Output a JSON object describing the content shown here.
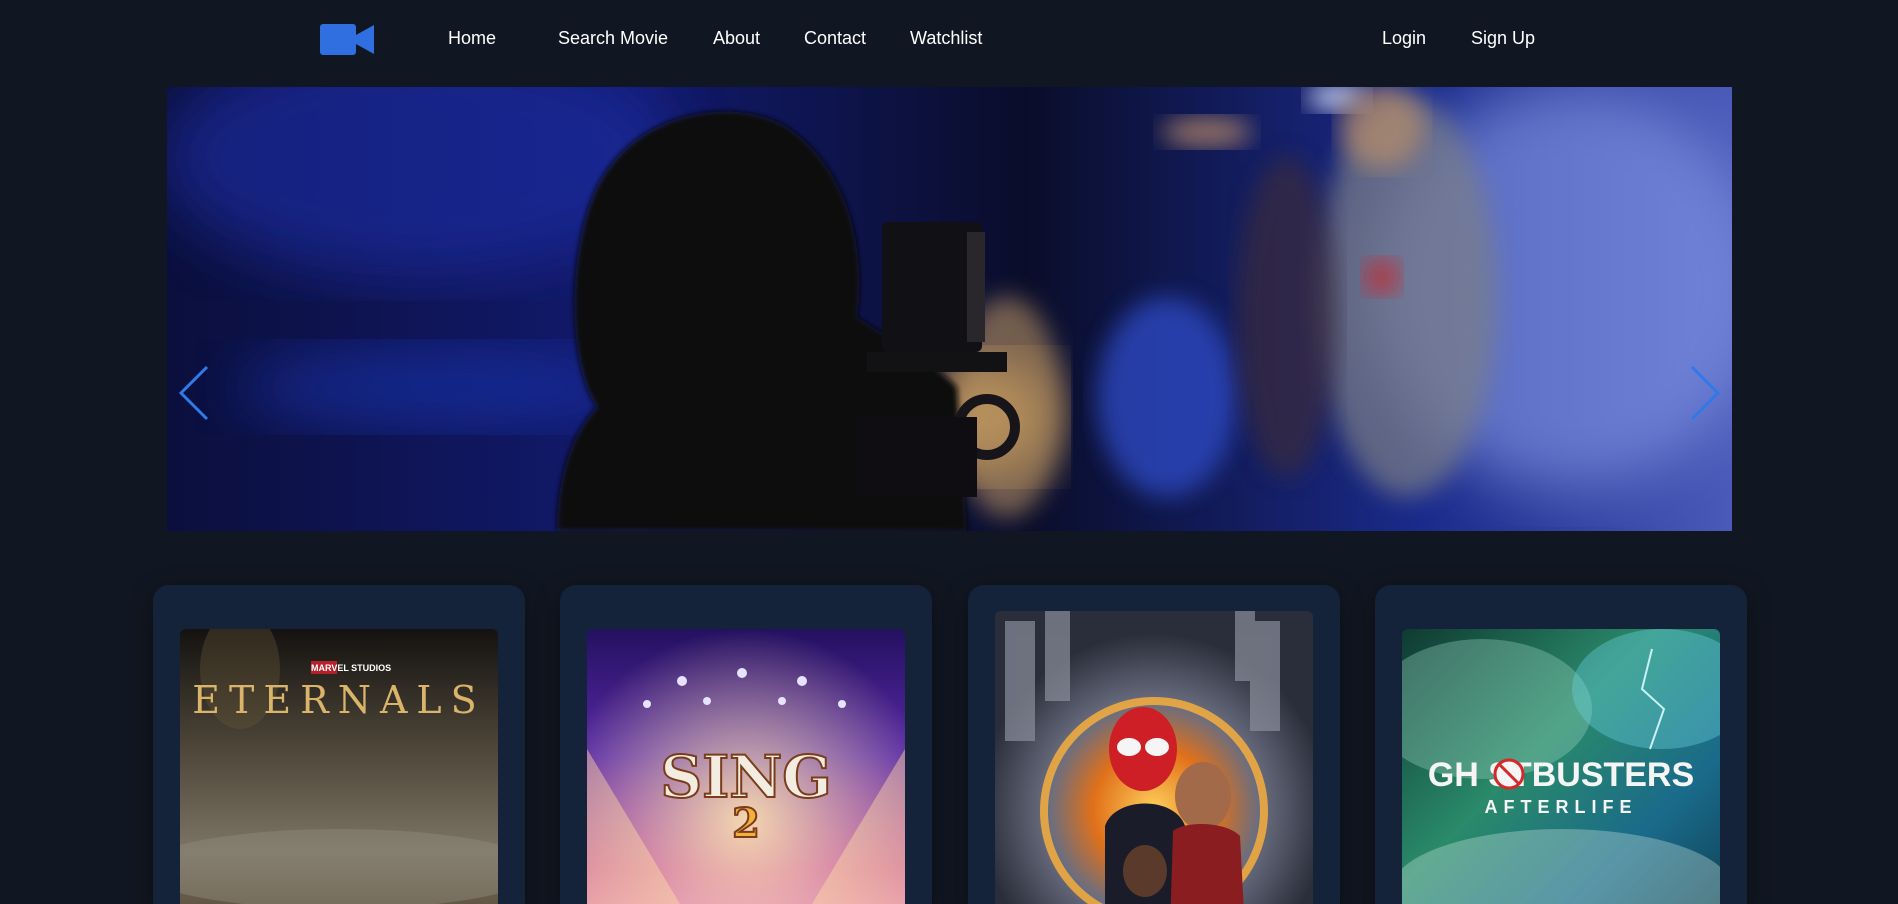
{
  "nav": {
    "logo_icon": "video-camera-icon",
    "brand_color": "#2f6fe0",
    "links": [
      "Home",
      "Search Movie",
      "About",
      "Contact",
      "Watchlist"
    ],
    "auth": [
      "Login",
      "Sign Up"
    ]
  },
  "carousel": {
    "prev_icon": "chevron-left-icon",
    "next_icon": "chevron-right-icon",
    "arrow_color": "#2f79e8"
  },
  "movies": [
    {
      "studio": "MARVEL STUDIOS",
      "title": "ETERNALS"
    },
    {
      "title": "SING",
      "number": "2"
    },
    {
      "title": ""
    },
    {
      "title": "GH  STBUSTERS",
      "subtitle": "AFTERLIFE"
    }
  ]
}
